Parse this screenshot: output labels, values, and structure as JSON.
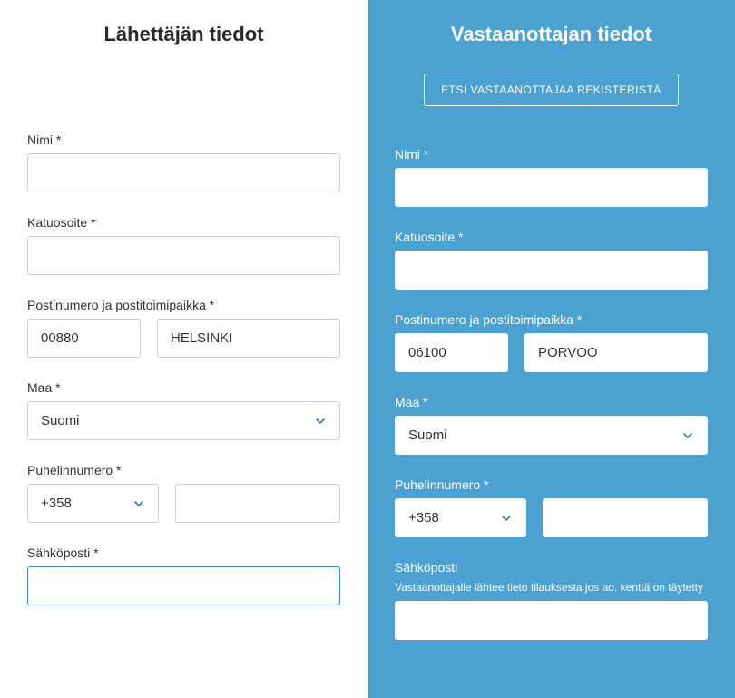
{
  "sender": {
    "title": "Lähettäjän tiedot",
    "name_label": "Nimi *",
    "name_value": "",
    "street_label": "Katuosoite *",
    "street_value": "",
    "postal_label": "Postinumero ja postitoimipaikka *",
    "postal_code_value": "00880",
    "postal_city_value": "HELSINKI",
    "country_label": "Maa *",
    "country_value": "Suomi",
    "phone_label": "Puhelinnumero *",
    "phone_code_value": "+358",
    "phone_number_value": "",
    "email_label": "Sähköposti *",
    "email_value": ""
  },
  "recipient": {
    "title": "Vastaanottajan tiedot",
    "search_button_label": "ETSI VASTAANOTTAJAA REKISTERISTÄ",
    "name_label": "Nimi *",
    "name_value": "",
    "street_label": "Katuosoite *",
    "street_value": "",
    "postal_label": "Postinumero ja postitoimipaikka *",
    "postal_code_value": "06100",
    "postal_city_value": "PORVOO",
    "country_label": "Maa *",
    "country_value": "Suomi",
    "phone_label": "Puhelinnumero *",
    "phone_code_value": "+358",
    "phone_number_value": "",
    "email_label": "Sähköposti",
    "email_helper": "Vastaanottajalle lähtee tieto tilauksesta jos ao. kenttä on täytetty",
    "email_value": ""
  }
}
